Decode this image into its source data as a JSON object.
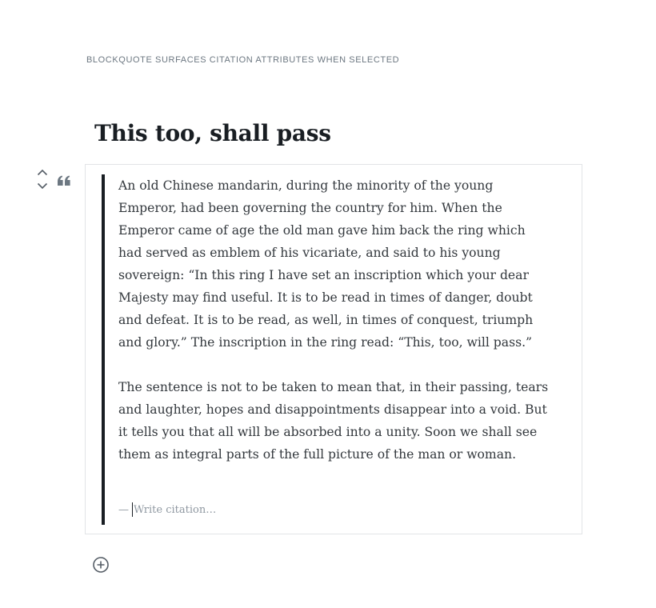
{
  "caption": "BLOCKQUOTE SURFACES CITATION ATTRIBUTES WHEN SELECTED",
  "post": {
    "title": "This too, shall pass"
  },
  "quote": {
    "paragraphs": [
      "An old Chinese mandarin, during the minority of the young Emperor, had been governing the country for him. When the Emperor came of age the old man gave him back the ring which had served as emblem of his vicariate, and said to his young sovereign: “In this ring I have set an inscription which your dear Majesty may find useful. It is to be read in times of danger, doubt and defeat. It is to be read, as well, in times of conquest, triumph and glory.” The inscription in the ring read: “This, too, will pass.”",
      "The sentence is not to be taken to mean that, in their passing, tears and laughter, hopes and disappointments disappear into a void. But it tells you that all will be absorbed into a unity. Soon we shall see them as integral parts of the full picture of the man or woman."
    ],
    "citation_dash": "—",
    "citation_placeholder": "Write citation…"
  },
  "icons": {
    "move_up": "chevron-up-icon",
    "move_down": "chevron-down-icon",
    "block_type": "quote-icon",
    "inserter": "plus-circle-icon"
  },
  "colors": {
    "text": "#32373c",
    "title": "#191e23",
    "quote_bar": "#191e23",
    "muted": "#8f98a1",
    "border": "#e2e4e7",
    "icon": "#555d66"
  }
}
